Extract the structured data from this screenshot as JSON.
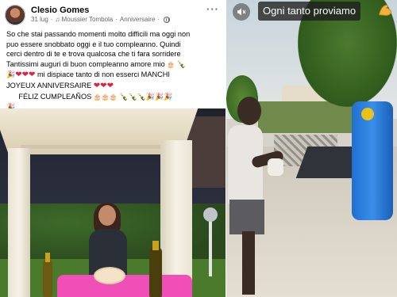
{
  "post": {
    "author": "Clesio Gomes",
    "date": "31 lug",
    "audio": "Moussier Tombola",
    "audio_suffix": "Anniversaire",
    "separator": "·",
    "more": "···",
    "lines": [
      "So che stai passando momenti molto difficili ma oggi non",
      "puo essere snobbato oggi e il tuo compleanno.  Quindi",
      "cerci dentro di te e trova qualcosa che ti fara sorridere",
      " Tantissimi auguri di buon compleanno amore mio",
      "mi dispiace tanto di non esserci  MANCHI",
      "JOYEUX ANNIVERSAIRE",
      "FÉLIZ CUMPLEAÑOS"
    ]
  },
  "video": {
    "caption": "Ogni tanto proviamo",
    "icons": {
      "mute": "speaker-muted-icon",
      "muscle": "flexed-biceps-icon"
    }
  },
  "colors": {
    "facebook_text": "#050505",
    "facebook_meta": "#65676b",
    "heart": "#e41e3f",
    "caption_bg": "#1e1e1e"
  }
}
